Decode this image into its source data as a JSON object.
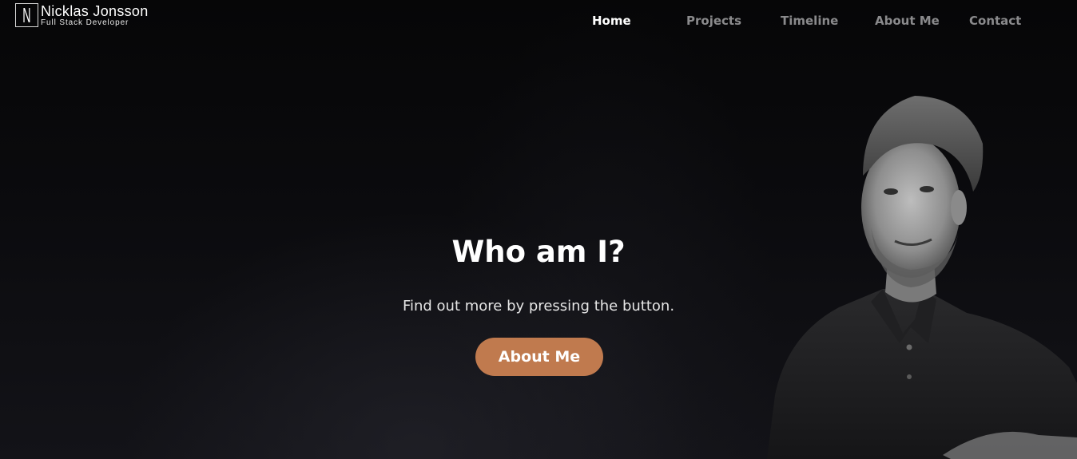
{
  "brand": {
    "monogram": "N",
    "name": "Nicklas Jonsson",
    "tagline": "Full Stack Developer"
  },
  "nav": {
    "items": [
      {
        "label": "Home",
        "active": true
      },
      {
        "label": "Projects",
        "active": false
      },
      {
        "label": "Timeline",
        "active": false
      },
      {
        "label": "About Me",
        "active": false
      },
      {
        "label": "Contact",
        "active": false
      }
    ]
  },
  "hero": {
    "title": "Who am I?",
    "subtitle": "Find out more by pressing the button.",
    "button_label": "About Me"
  },
  "colors": {
    "background": "#0b0b0d",
    "accent": "#c07a4e",
    "nav_active": "#ffffff",
    "nav_inactive": "#8a8a8c"
  },
  "icons": {
    "portrait": "person-portrait"
  }
}
